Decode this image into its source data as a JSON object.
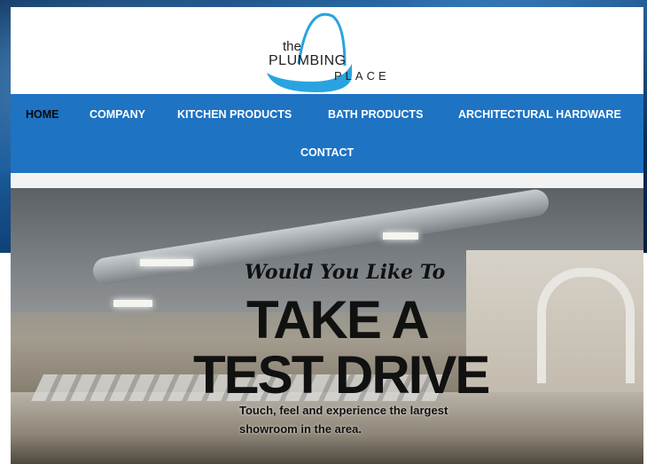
{
  "logo": {
    "word_the": "the",
    "word_plumbing": "PLUMBING",
    "word_place": "PLACE",
    "accent": "#29a3df"
  },
  "nav": {
    "background": "#1e73c2",
    "items": [
      {
        "label": "HOME",
        "active": true
      },
      {
        "label": "COMPANY",
        "active": false
      },
      {
        "label": "KITCHEN PRODUCTS",
        "active": false
      },
      {
        "label": "BATH PRODUCTS",
        "active": false
      },
      {
        "label": "ARCHITECTURAL HARDWARE",
        "active": false
      },
      {
        "label": "CONTACT",
        "active": false
      }
    ]
  },
  "hero": {
    "tagline": "Would You Like To",
    "headline_line1": "TAKE A",
    "headline_line2": "TEST DRIVE",
    "subtext": "Touch, feel and experience the largest showroom in the area."
  }
}
